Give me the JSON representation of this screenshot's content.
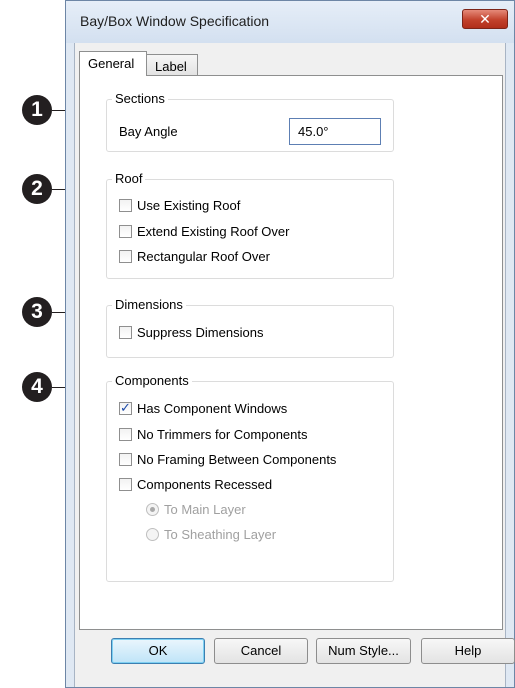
{
  "window": {
    "title": "Bay/Box Window Specification",
    "close_glyph": "✕"
  },
  "tabs": [
    {
      "label": "General",
      "selected": true
    },
    {
      "label": "Label",
      "selected": false
    }
  ],
  "callouts": [
    "1",
    "2",
    "3",
    "4"
  ],
  "sections": {
    "title": "Sections",
    "bay_angle_label": "Bay Angle",
    "bay_angle_value": "45.0°"
  },
  "roof": {
    "title": "Roof",
    "items": [
      {
        "label": "Use Existing Roof",
        "checked": false
      },
      {
        "label": "Extend Existing Roof Over",
        "checked": false
      },
      {
        "label": "Rectangular Roof Over",
        "checked": false
      }
    ]
  },
  "dimensions": {
    "title": "Dimensions",
    "items": [
      {
        "label": "Suppress Dimensions",
        "checked": false
      }
    ]
  },
  "components": {
    "title": "Components",
    "items": [
      {
        "label": "Has Component Windows",
        "checked": true
      },
      {
        "label": "No Trimmers for Components",
        "checked": false
      },
      {
        "label": "No Framing Between Components",
        "checked": false
      },
      {
        "label": "Components Recessed",
        "checked": false
      }
    ],
    "radios": [
      {
        "label": "To Main Layer",
        "selected": true,
        "disabled": true
      },
      {
        "label": "To Sheathing Layer",
        "selected": false,
        "disabled": true
      }
    ]
  },
  "buttons": {
    "ok": "OK",
    "cancel": "Cancel",
    "num_style": "Num Style...",
    "help": "Help"
  },
  "colors": {
    "title_bar": "#dfe8f3",
    "close_button": "#c2412c",
    "default_button_border": "#3c7fb1"
  }
}
